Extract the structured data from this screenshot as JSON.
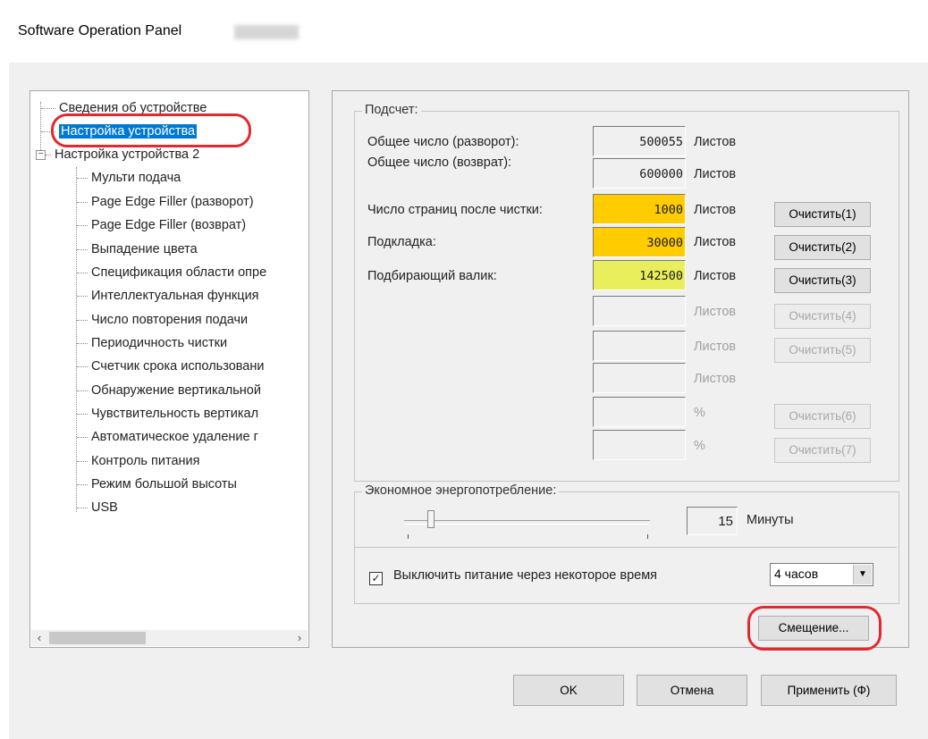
{
  "window": {
    "title": "Software Operation Panel"
  },
  "tree": {
    "items": [
      {
        "label": "Сведения об устройстве"
      },
      {
        "label": "Настройка устройства"
      },
      {
        "label": "Настройка устройства 2"
      },
      {
        "label": "Мульти подача"
      },
      {
        "label": "Page Edge Filler (разворот)"
      },
      {
        "label": "Page Edge Filler (возврат)"
      },
      {
        "label": "Выпадение цвета"
      },
      {
        "label": "Спецификация области опре"
      },
      {
        "label": "Интеллектуальная функция"
      },
      {
        "label": "Число повторения подачи"
      },
      {
        "label": "Периодичность чистки"
      },
      {
        "label": "Счетчик срока использовани"
      },
      {
        "label": "Обнаружение вертикальной"
      },
      {
        "label": "Чувствительность вертикал"
      },
      {
        "label": "Автоматическое удаление г"
      },
      {
        "label": "Контроль питания"
      },
      {
        "label": "Режим большой высоты"
      },
      {
        "label": "USB"
      }
    ],
    "selected_index": 1,
    "expander_symbol": "−"
  },
  "counter": {
    "group_label": "Подсчет:",
    "rows": [
      {
        "label": "Общее число (разворот):",
        "value": "500055",
        "unit": "Листов"
      },
      {
        "label": "Общее число (возврат):",
        "value": "600000",
        "unit": "Листов"
      },
      {
        "label": "Число страниц после чистки:",
        "value": "1000",
        "unit": "Листов",
        "button": "Очистить(1)"
      },
      {
        "label": "Подкладка:",
        "value": "30000",
        "unit": "Листов",
        "button": "Очистить(2)"
      },
      {
        "label": "Подбирающий валик:",
        "value": "142500",
        "unit": "Листов",
        "button": "Очистить(3)"
      },
      {
        "label": "",
        "value": "",
        "unit": "Листов",
        "button": "Очистить(4)"
      },
      {
        "label": "",
        "value": "",
        "unit": "Листов",
        "button": "Очистить(5)"
      },
      {
        "label": "",
        "value": "",
        "unit": "Листов"
      },
      {
        "label": "",
        "value": "",
        "unit": "%",
        "button": "Очистить(6)"
      },
      {
        "label": "",
        "value": "",
        "unit": "%",
        "button": "Очистить(7)"
      }
    ]
  },
  "power": {
    "group_label": "Экономное энергопотребление:",
    "minutes_value": "15",
    "minutes_unit": "Минуты",
    "slider_level_fraction": 0.1,
    "auto_off_checked": true,
    "check_mark": "✓",
    "auto_off_label": "Выключить питание через некоторое время",
    "auto_off_option": "4 часов",
    "dropdown_arrow": "▼"
  },
  "buttons": {
    "offset": "Смещение...",
    "ok": "OK",
    "cancel": "Отмена",
    "apply": "Применить (Ф)"
  },
  "scroll": {
    "left_arrow": "‹",
    "right_arrow": "›"
  },
  "colors": {
    "selection": "#0078d7",
    "highlight_orange": "#ffcc00",
    "highlight_yellow": "#e9ee5c",
    "annotation_red": "#e4282e"
  }
}
